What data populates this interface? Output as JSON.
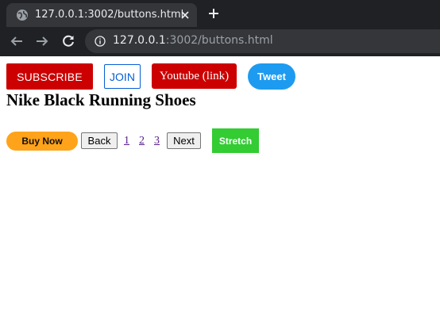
{
  "browser": {
    "tab_title": "127.0.0.1:3002/buttons.html",
    "url_host": "127.0.0.1",
    "url_path": ":3002/buttons.html",
    "chrome_color": "#202124"
  },
  "buttons_row": {
    "subscribe_label": "SUBSCRIBE",
    "join_label": "JOIN",
    "youtube_label": "Youtube (link)",
    "tweet_label": "Tweet"
  },
  "product": {
    "title": "Nike Black Running Shoes"
  },
  "actions_row": {
    "buy_label": "Buy Now",
    "back_label": "Back",
    "pages": [
      "1",
      "2",
      "3"
    ],
    "next_label": "Next",
    "stretch_label": "Stretch"
  },
  "colors": {
    "youtube_red": "#cc0000",
    "join_blue": "#065fd4",
    "tweet_blue": "#1d9bf0",
    "buy_orange": "#ffa31a",
    "stretch_green": "#33cc33",
    "visited_link": "#551a8b"
  },
  "icons": [
    "globe-icon",
    "close-icon",
    "plus-icon",
    "arrow-left-icon",
    "arrow-right-icon",
    "reload-icon",
    "info-icon"
  ]
}
